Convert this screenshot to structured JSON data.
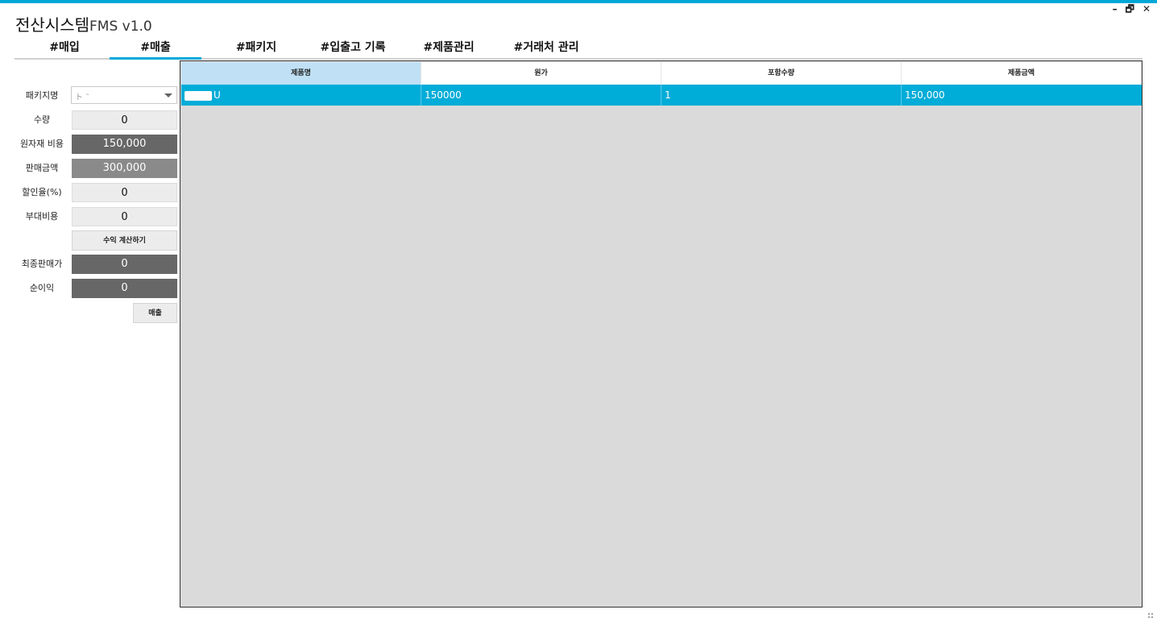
{
  "app": {
    "title_main": "전산시스템",
    "title_suffix": "FMS v1.0"
  },
  "window_controls": {
    "minimize": "–",
    "restore": "🗗",
    "close": "✕"
  },
  "tabs": [
    {
      "label": "#매입",
      "active": false
    },
    {
      "label": "#매출",
      "active": true
    },
    {
      "label": "#패키지",
      "active": false
    },
    {
      "label": "#입출고 기록",
      "active": false
    },
    {
      "label": "#제품관리",
      "active": false
    },
    {
      "label": "#거래처 관리",
      "active": false
    }
  ],
  "form": {
    "package_label": "패키지명",
    "package_value": "ト  ˜",
    "quantity_label": "수량",
    "quantity_value": "0",
    "material_cost_label": "원자재 비용",
    "material_cost_value": "150,000",
    "sale_amount_label": "판매금액",
    "sale_amount_value": "300,000",
    "discount_label": "할인율(%)",
    "discount_value": "0",
    "extra_cost_label": "부대비용",
    "extra_cost_value": "0",
    "calc_button": "수익 계산하기",
    "final_price_label": "최종판매가",
    "final_price_value": "0",
    "net_profit_label": "순이익",
    "net_profit_value": "0",
    "sell_button": "매출"
  },
  "grid": {
    "columns": [
      "제품명",
      "원가",
      "포함수량",
      "제품금액"
    ],
    "rows": [
      {
        "name": "U",
        "cost": "150000",
        "qty": "1",
        "amount": "150,000"
      }
    ]
  },
  "colors": {
    "accent": "#00a8d8",
    "row_selected": "#00acd8",
    "header_selected": "#bfe0f5",
    "dark_box": "#676767",
    "grid_bg": "#dadada"
  }
}
